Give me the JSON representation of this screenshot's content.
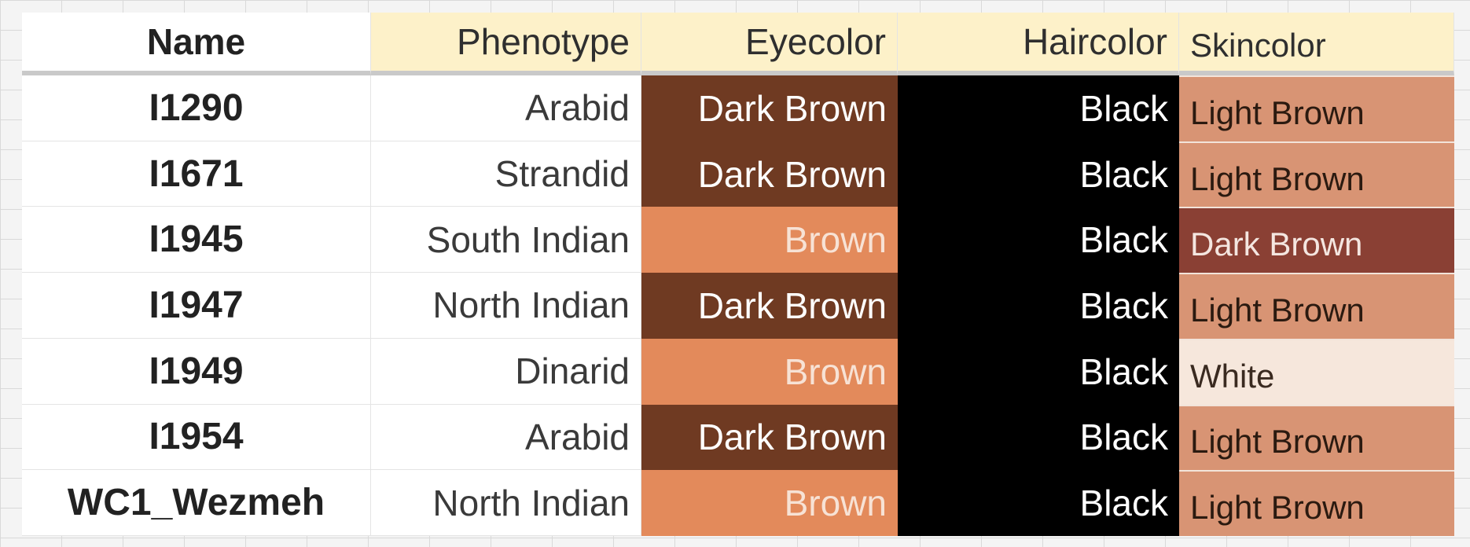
{
  "table": {
    "headers": [
      "Name",
      "Phenotype",
      "Eyecolor",
      "Haircolor",
      "Skincolor"
    ],
    "rows": [
      {
        "name": "I1290",
        "phenotype": "Arabid",
        "eyecolor": "Dark Brown",
        "haircolor": "Black",
        "skincolor": "Light Brown"
      },
      {
        "name": "I1671",
        "phenotype": "Strandid",
        "eyecolor": "Dark Brown",
        "haircolor": "Black",
        "skincolor": "Light Brown"
      },
      {
        "name": "I1945",
        "phenotype": "South Indian",
        "eyecolor": "Brown",
        "haircolor": "Black",
        "skincolor": "Dark Brown"
      },
      {
        "name": "I1947",
        "phenotype": "North Indian",
        "eyecolor": "Dark Brown",
        "haircolor": "Black",
        "skincolor": "Light Brown"
      },
      {
        "name": "I1949",
        "phenotype": "Dinarid",
        "eyecolor": "Brown",
        "haircolor": "Black",
        "skincolor": "White"
      },
      {
        "name": "I1954",
        "phenotype": "Arabid",
        "eyecolor": "Dark Brown",
        "haircolor": "Black",
        "skincolor": "Light Brown"
      },
      {
        "name": "WC1_Wezmeh",
        "phenotype": "North Indian",
        "eyecolor": "Brown",
        "haircolor": "Black",
        "skincolor": "Light Brown"
      }
    ]
  },
  "colors": {
    "header_bg": "#fdf1c9",
    "eye_dark_brown": "#6f3a22",
    "eye_brown": "#e38a5b",
    "hair_black": "#000000",
    "skin_light_brown": "#d89474",
    "skin_dark_brown": "#8a4034",
    "skin_white": "#f6e7dc"
  }
}
